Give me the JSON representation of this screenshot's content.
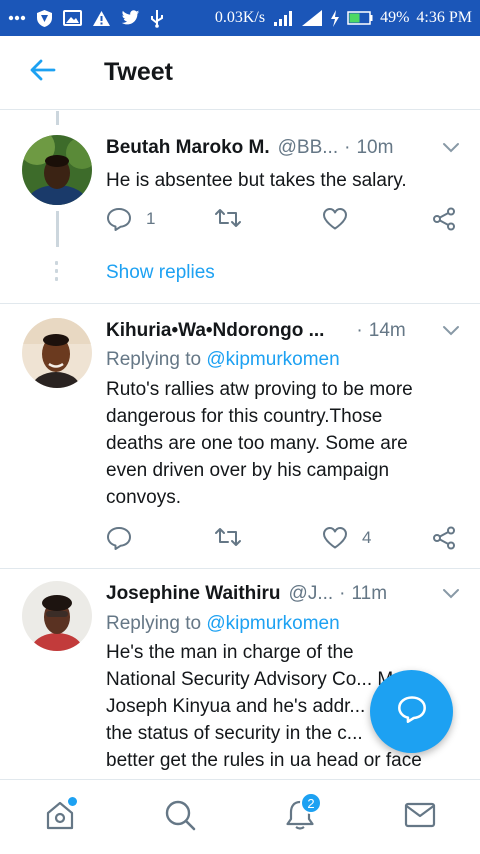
{
  "status_bar": {
    "speed": "0.03K/s",
    "battery": "49%",
    "time": "4:36 PM"
  },
  "header": {
    "title": "Tweet"
  },
  "tweets": [
    {
      "name": "Beutah Maroko M.",
      "handle": "@BB...",
      "separator": "·",
      "time": "10m",
      "text": "He is absentee but takes the salary.",
      "reply_count": "1",
      "like_count": ""
    },
    {
      "name": "Kihuria•Wa•Ndorongo ...",
      "handle": "",
      "separator": "·",
      "time": "14m",
      "replying_prefix": "Replying to",
      "replying_to": "@kipmurkomen",
      "text_lines": [
        "Ruto's rallies atw proving to be more",
        "dangerous for this country.Those",
        "deaths are one too many. Some are",
        "even driven over by his campaign",
        "convoys."
      ],
      "reply_count": "",
      "like_count": "4"
    },
    {
      "name": "Josephine Waithiru",
      "handle": "@J...",
      "separator": "·",
      "time": "11m",
      "replying_prefix": "Replying to",
      "replying_to": "@kipmurkomen",
      "text_lines": [
        "He's the man in charge of the",
        "National Security Advisory Co...    Mr",
        "Joseph Kinyua and he's addr...",
        "the status of security in the c...",
        "better get the rules in ua head or face"
      ]
    }
  ],
  "show_replies": "Show replies",
  "bottom_nav": {
    "notifications_badge": "2"
  },
  "colors": {
    "accent": "#1da1f2",
    "status_bar": "#1b56b8",
    "secondary_text": "#657786"
  }
}
